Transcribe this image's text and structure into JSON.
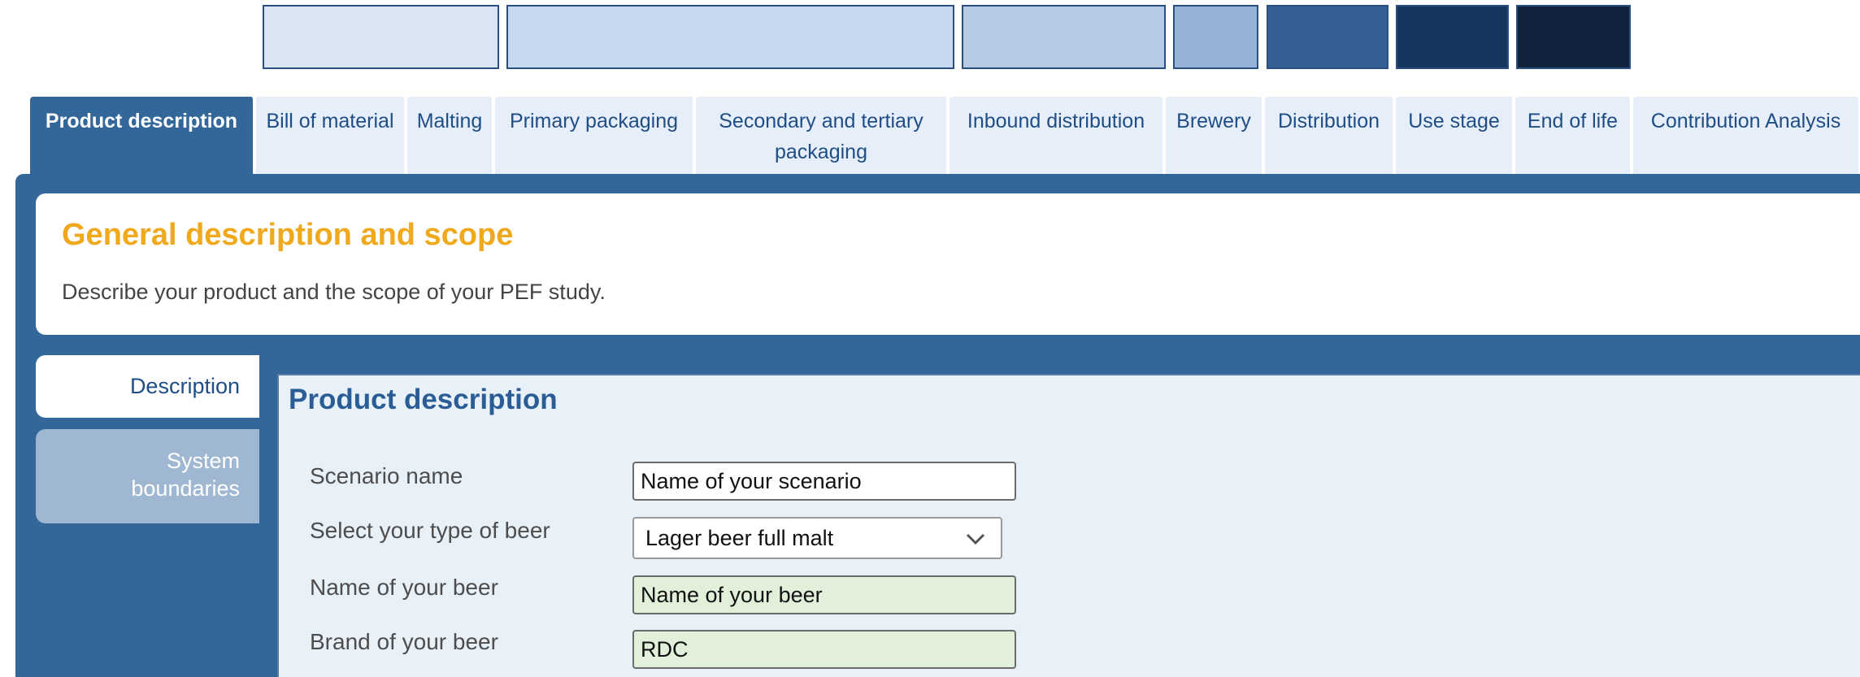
{
  "swatches": [
    "#dbe5f1",
    "#c6d9f0",
    "#b6cbe3",
    "#94b3d6",
    "#345f94",
    "#17365d",
    "#12233d"
  ],
  "tabs": [
    {
      "label": "Product description",
      "active": true
    },
    {
      "label": "Bill of material"
    },
    {
      "label": "Malting"
    },
    {
      "label": "Primary packaging"
    },
    {
      "label": "Secondary and tertiary packaging"
    },
    {
      "label": "Inbound distribution"
    },
    {
      "label": "Brewery"
    },
    {
      "label": "Distribution"
    },
    {
      "label": "Use stage"
    },
    {
      "label": "End of life"
    },
    {
      "label": "Contribution Analysis"
    }
  ],
  "scope": {
    "title": "General description and scope",
    "description": "Describe your product and the scope of your PEF study."
  },
  "side_tabs": [
    {
      "label": "Description",
      "active": true
    },
    {
      "label": "System boundaries"
    }
  ],
  "form": {
    "title": "Product description",
    "scenario_name": {
      "label": "Scenario name",
      "value": "Name of your scenario"
    },
    "beer_type": {
      "label": "Select your type of beer",
      "value": "Lager beer full malt"
    },
    "beer_name": {
      "label": "Name of your beer",
      "value": "Name of your beer"
    },
    "brand": {
      "label": "Brand of your beer",
      "value": "RDC"
    }
  },
  "colors": {
    "accent": "#f0a81c",
    "panel": "#336699",
    "field_green": "#e2efd9"
  },
  "icons": {
    "dropdown": "chevron-down-icon"
  }
}
